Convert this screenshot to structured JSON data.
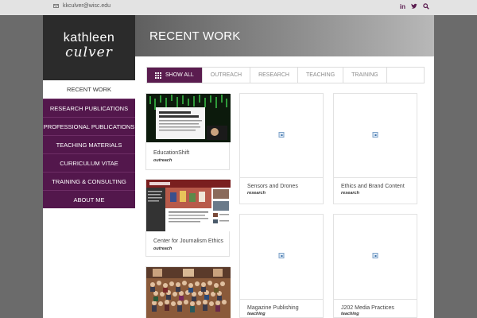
{
  "topbar": {
    "email": "kkculver@wisc.edu",
    "social": [
      "in",
      "t",
      "search"
    ],
    "social_text": {
      "linkedin": "in",
      "twitter": "t"
    }
  },
  "brand": {
    "first": "kathleen",
    "last": "culver"
  },
  "page_title": "RECENT WORK",
  "nav": [
    "RECENT WORK",
    "RESEARCH PUBLICATIONS",
    "PROFESSIONAL PUBLICATIONS",
    "TEACHING MATERIALS",
    "CURRICULUM VITAE",
    "TRAINING & CONSULTING",
    "ABOUT ME"
  ],
  "filters": [
    "SHOW ALL",
    "OUTREACH",
    "RESEARCH",
    "TEACHING",
    "TRAINING"
  ],
  "cards": [
    {
      "title": "EducationShift",
      "tag": "outreach",
      "thumb": "image"
    },
    {
      "title": "Sensors and Drones",
      "tag": "research",
      "thumb": "broken"
    },
    {
      "title": "Ethics and Brand Content",
      "tag": "research",
      "thumb": "broken"
    },
    {
      "title": "Center for Journalism Ethics",
      "tag": "outreach",
      "thumb": "image"
    },
    {
      "title": "Magazine Publishing",
      "tag": "teaching",
      "thumb": "broken"
    },
    {
      "title": "J202 Media Practices",
      "tag": "teaching",
      "thumb": "broken"
    },
    {
      "title": "",
      "tag": "",
      "thumb": "image"
    }
  ],
  "colors": {
    "accent": "#53174c",
    "banner": "#8e8e8e",
    "topbar": "#e3e3e3"
  },
  "icons": [
    "mail-icon",
    "linkedin-icon",
    "twitter-icon",
    "search-icon",
    "grid-icon",
    "broken-image-icon"
  ]
}
